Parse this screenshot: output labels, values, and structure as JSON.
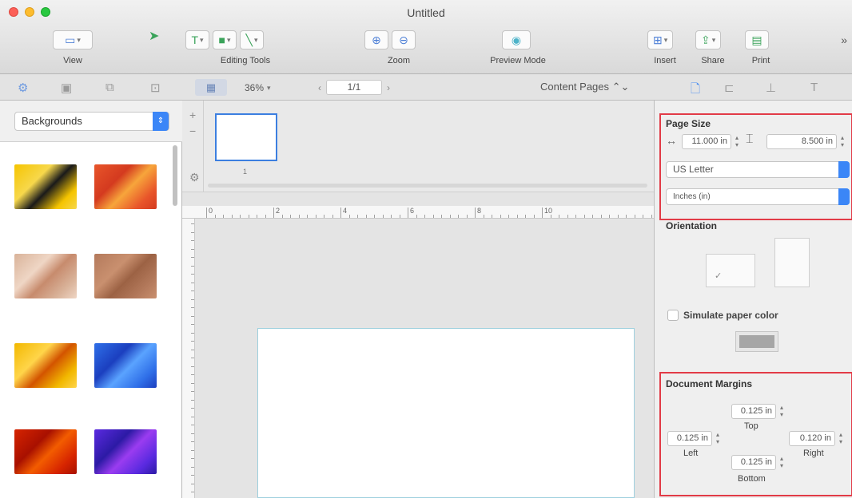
{
  "window": {
    "title": "Untitled"
  },
  "toolbar": {
    "view_label": "View",
    "editing_tools_label": "Editing Tools",
    "zoom_label": "Zoom",
    "preview_mode_label": "Preview Mode",
    "insert_label": "Insert",
    "share_label": "Share",
    "print_label": "Print"
  },
  "subbar": {
    "zoom_value": "36%",
    "page_field": "1/1",
    "content_pages": "Content Pages"
  },
  "left_panel": {
    "category": "Backgrounds",
    "thumbs": [
      {
        "name": "yellow-abstract",
        "colors": [
          "#f5c400",
          "#1a1a1a",
          "#f7d84c"
        ]
      },
      {
        "name": "orange-stripes",
        "colors": [
          "#e8552a",
          "#f7a53b",
          "#d43a1f"
        ]
      },
      {
        "name": "beige-texture",
        "colors": [
          "#d9b39a",
          "#c78b6d",
          "#efd6c5"
        ]
      },
      {
        "name": "brown-leather",
        "colors": [
          "#b47a5c",
          "#9c6244",
          "#c9906f"
        ]
      },
      {
        "name": "yellow-flowers",
        "colors": [
          "#f2b800",
          "#d35400",
          "#ffd54a"
        ]
      },
      {
        "name": "blue-watercolor",
        "colors": [
          "#2f6fe8",
          "#5aa3ff",
          "#1b3fbf"
        ]
      },
      {
        "name": "red-orange-paint",
        "colors": [
          "#d62400",
          "#f35c00",
          "#a81000"
        ]
      },
      {
        "name": "purple-galaxy",
        "colors": [
          "#5a2ae0",
          "#9a3cf0",
          "#2c1aa5"
        ]
      }
    ]
  },
  "ruler": {
    "labels": [
      "0",
      "2",
      "4",
      "6",
      "8",
      "10"
    ]
  },
  "navigator": {
    "page_number": "1"
  },
  "inspector": {
    "page_size_title": "Page Size",
    "width": "11.000 in",
    "height": "8.500 in",
    "paper": "US Letter",
    "units": "Inches (in)",
    "orientation_title": "Orientation",
    "simulate_paper_color": "Simulate paper color",
    "margins_title": "Document Margins",
    "margin_top": "0.125 in",
    "margin_left": "0.125 in",
    "margin_right": "0.120 in",
    "margin_bottom": "0.125 in",
    "top_label": "Top",
    "left_label": "Left",
    "right_label": "Right",
    "bottom_label": "Bottom"
  },
  "colors": {
    "accent": "#3b86f7",
    "highlight": "#e23b47"
  }
}
